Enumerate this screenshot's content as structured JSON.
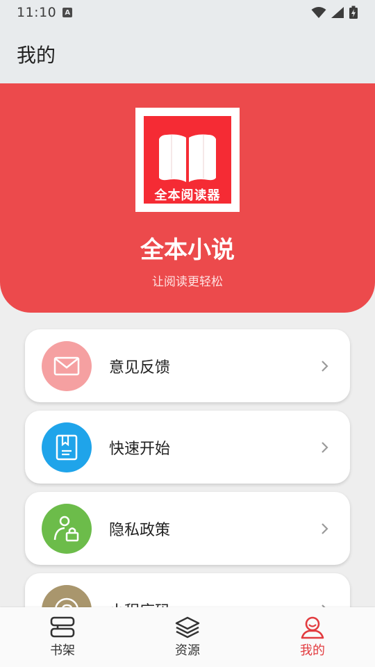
{
  "status_bar": {
    "time": "11:10",
    "notification_badge": "A"
  },
  "app_bar": {
    "title": "我的"
  },
  "hero": {
    "logo_caption": "全本阅读器",
    "app_name": "全本小说",
    "slogan": "让阅读更轻松",
    "background_color": "#ec4a4c"
  },
  "menu": {
    "items": [
      {
        "label": "意见反馈",
        "icon": "mail-icon",
        "color": "#f5a0a1"
      },
      {
        "label": "快速开始",
        "icon": "bookmark-book-icon",
        "color": "#1fa4ea"
      },
      {
        "label": "隐私政策",
        "icon": "user-lock-icon",
        "color": "#6cbc4a"
      },
      {
        "label": "小程序码",
        "icon": "mini-program-icon",
        "color": "#a9966d"
      }
    ]
  },
  "bottom_nav": {
    "items": [
      {
        "label": "书架",
        "icon": "bookshelf-icon",
        "active": false
      },
      {
        "label": "资源",
        "icon": "layers-icon",
        "active": false
      },
      {
        "label": "我的",
        "icon": "profile-icon",
        "active": true
      }
    ],
    "active_color": "#e23b3f"
  }
}
